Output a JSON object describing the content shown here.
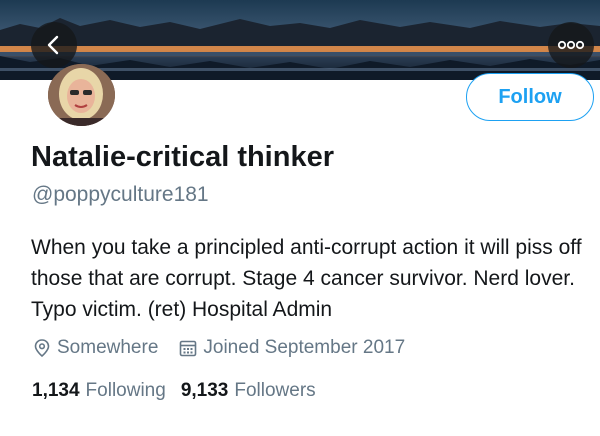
{
  "banner": {
    "image": "lake-sunset-banner"
  },
  "nav": {
    "back_icon": "chevron-left-icon",
    "more_icon": "more-horizontal-icon"
  },
  "profile": {
    "display_name": "Natalie-critical thinker",
    "handle": "@poppyculture181",
    "follow_label": "Follow",
    "bio": "When you take a principled anti-corrupt action it will piss off those that are corrupt. Stage 4 cancer survivor. Nerd lover. Typo victim. (ret) Hospital Admin",
    "location": "Somewhere",
    "joined": "Joined September 2017"
  },
  "stats": {
    "following_count": "1,134",
    "following_label": "Following",
    "followers_count": "9,133",
    "followers_label": "Followers"
  },
  "colors": {
    "accent": "#1da1f2",
    "secondary_text": "#657786",
    "primary_text": "#14171a"
  }
}
